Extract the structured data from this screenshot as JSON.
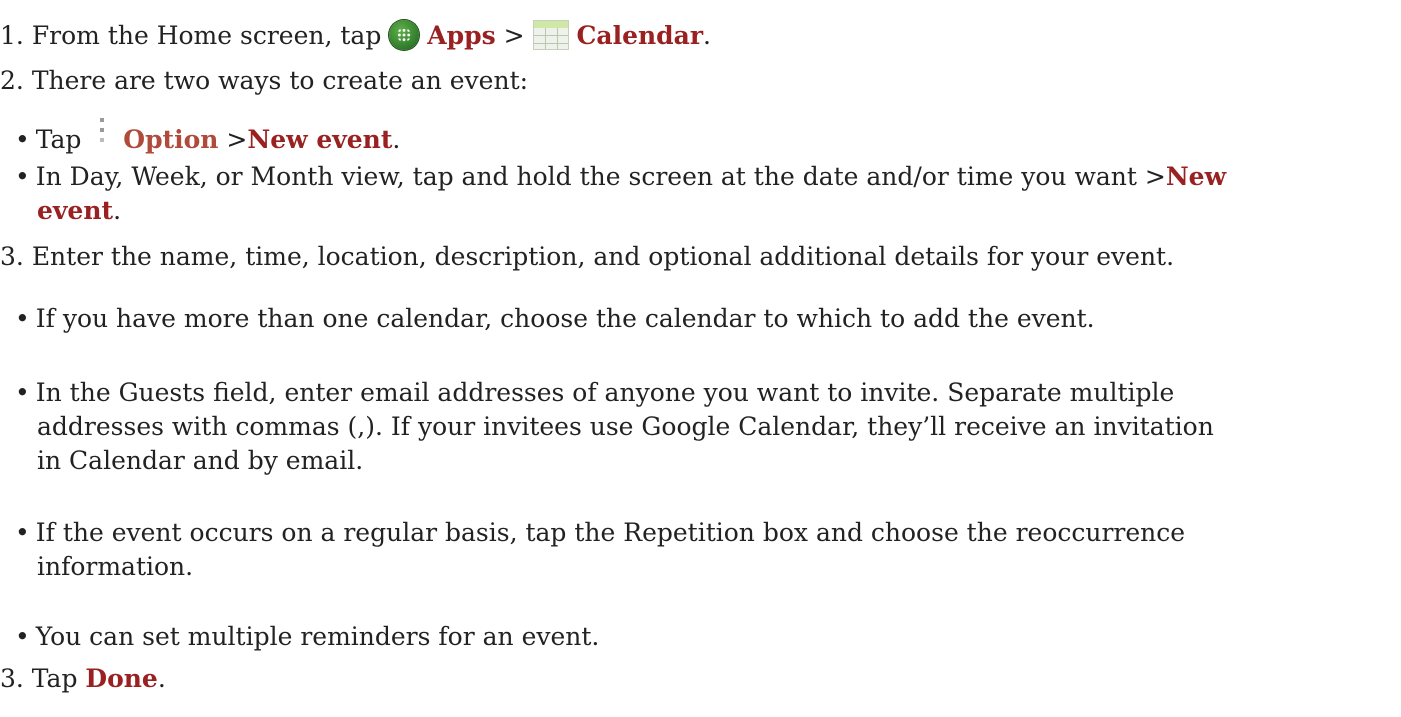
{
  "steps": [
    {
      "num": "1.",
      "pre": "From the Home screen, tap ",
      "apps": "Apps",
      "sep": " > ",
      "calendar": "Calendar",
      "post": "."
    },
    {
      "num": "2.",
      "text": "There are two ways to create an event:"
    },
    {
      "num": "3.",
      "text": "Enter the name, time, location, description, and optional additional details for your event."
    },
    {
      "num": "3.",
      "pre": " Tap ",
      "done": "Done",
      "post": "."
    }
  ],
  "ways": [
    {
      "pre": "Tap ",
      "option": "Option",
      "mid": " >",
      "new_event": "New event",
      "post": "."
    },
    {
      "pre": "In Day, Week, or Month view, tap and hold the screen at the date and/or time you want >",
      "new_1": "New",
      "new_2": "event",
      "post": "."
    }
  ],
  "details": [
    {
      "text": "If you have more than one calendar, choose the calendar to which to add the event."
    },
    {
      "line1": "In the Guests field, enter email addresses of anyone you want to invite. Separate multiple",
      "line2": "addresses with commas (,). If your invitees use Google Calendar, they’ll receive an invitation",
      "line3": "in Calendar and by email."
    },
    {
      "line1": "If the event occurs on a regular basis, tap the Repetition box and choose the reoccurrence",
      "line2": "information."
    },
    {
      "text": "You can set multiple reminders for an event."
    }
  ],
  "bullet": "•",
  "icons": {
    "apps": "apps-icon",
    "calendar": "calendar-icon",
    "option": "overflow-menu-icon"
  },
  "colors": {
    "keyword": "#9a2121",
    "text": "#222222"
  }
}
